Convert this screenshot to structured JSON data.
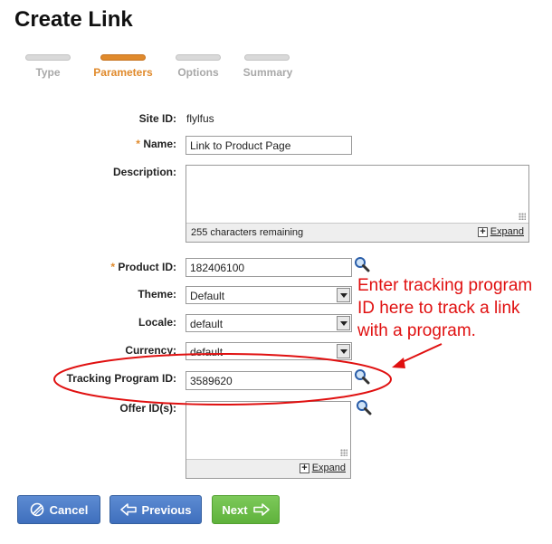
{
  "page": {
    "title": "Create Link"
  },
  "steps": [
    {
      "label": "Type",
      "active": false
    },
    {
      "label": "Parameters",
      "active": true
    },
    {
      "label": "Options",
      "active": false
    },
    {
      "label": "Summary",
      "active": false
    }
  ],
  "form": {
    "site_id": {
      "label": "Site ID:",
      "value": "flylfus"
    },
    "name": {
      "label": "Name:",
      "value": "Link to Product Page",
      "required_mark": "*"
    },
    "description": {
      "label": "Description:",
      "value": "",
      "chars_remaining": "255 characters remaining",
      "expand_label": "Expand"
    },
    "product_id": {
      "label": "Product ID:",
      "value": "182406100",
      "required_mark": "*"
    },
    "theme": {
      "label": "Theme:",
      "selected": "Default"
    },
    "locale": {
      "label": "Locale:",
      "selected": "default"
    },
    "currency": {
      "label": "Currency:",
      "selected": "default"
    },
    "tracking_program_id": {
      "label": "Tracking Program ID:",
      "value": "3589620"
    },
    "offer_ids": {
      "label": "Offer ID(s):",
      "value": "",
      "expand_label": "Expand"
    }
  },
  "annotation": {
    "lines": [
      "Enter tracking program",
      "ID here to track a link",
      "with a program."
    ],
    "color": "#e01010"
  },
  "buttons": {
    "cancel": "Cancel",
    "previous": "Previous",
    "next": "Next"
  },
  "icons": {
    "lookup": "magnifier-icon",
    "cancel": "cancel-circle-icon",
    "previous": "arrow-left-icon",
    "next": "arrow-right-icon",
    "expand": "plus-box-icon"
  },
  "colors": {
    "accent": "#e08a2c",
    "button_blue": "#4a7cc6",
    "button_green": "#6cbd47"
  }
}
